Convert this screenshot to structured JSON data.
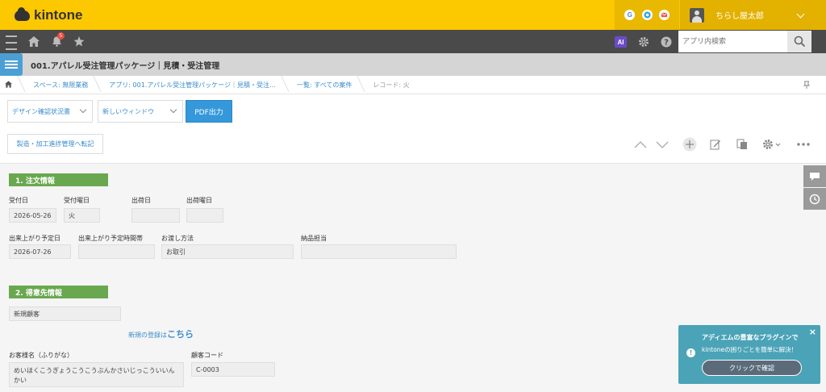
{
  "header": {
    "logo_text": "kintone",
    "service_icons": [
      "google-icon",
      "chrome-icon",
      "mail-icon"
    ],
    "user_name": "ちらし屋太郎",
    "accent_color": "#fcc800"
  },
  "navbar": {
    "notification_count": "5",
    "ai_label": "AI",
    "search_placeholder": "アプリ内検索"
  },
  "app": {
    "title": "001.アパレル受注管理パッケージ｜見積・受注管理"
  },
  "breadcrumb": [
    "スペース: 無限業務",
    "アプリ: 001.アパレル受注管理パッケージ｜見積・受注…",
    "一覧: すべての案件",
    "レコード: 火"
  ],
  "toolbar": {
    "print_select": "デザイン確認状況書",
    "window_select": "新しいウィンドウ",
    "pdf_button": "PDF出力",
    "transfer_button": "製造・加工進捗管理へ転記"
  },
  "sections": {
    "order": {
      "title": "1. 注文情報",
      "fields": {
        "receipt_date_label": "受付日",
        "receipt_date": "2026-05-26",
        "receipt_weekday_label": "受付曜日",
        "receipt_weekday": "火",
        "ship_date_label": "出荷日",
        "ship_date": "",
        "ship_weekday_label": "出荷曜日",
        "ship_weekday": "",
        "finish_date_label": "出来上がり予定日",
        "finish_date": "2026-07-26",
        "finish_time_label": "出来上がり予定時間帯",
        "finish_time": "",
        "delivery_method_label": "お渡し方法",
        "delivery_method": "お取引",
        "delivery_staff_label": "納品担当",
        "delivery_staff": ""
      }
    },
    "customer": {
      "title": "2. 得意先情報",
      "type": "新規顧客",
      "register_prefix": "新規の登録は",
      "register_link": "こちら",
      "kana_label": "お客様名（ふりがな）",
      "kana_value": "めいほくこうぎょうこうこうぶんかさいじっこういいんかい",
      "code_label": "顧客コード",
      "code_value": "C-0003"
    }
  },
  "popup": {
    "title": "アディエムの豊富なプラグインで",
    "body": "kintoneの困りごとを簡単に解決！",
    "button": "クリックで確認",
    "close": "×"
  }
}
